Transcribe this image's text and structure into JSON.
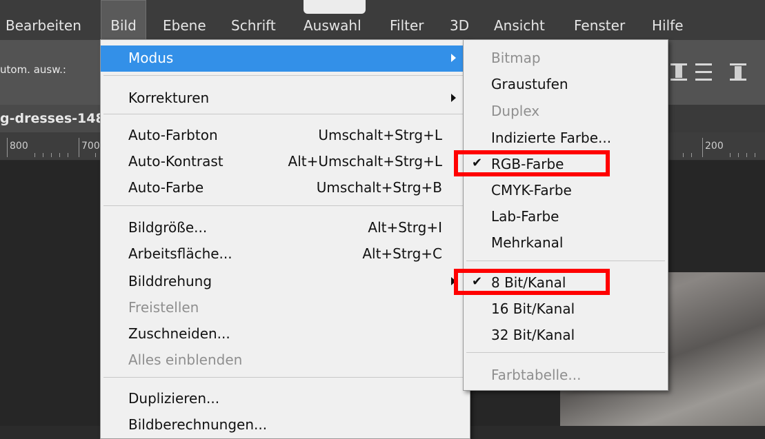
{
  "menubar": {
    "items": [
      {
        "label": "Bearbeiten"
      },
      {
        "label": "Bild"
      },
      {
        "label": "Ebene"
      },
      {
        "label": "Schrift"
      },
      {
        "label": "Auswahl"
      },
      {
        "label": "Filter"
      },
      {
        "label": "3D"
      },
      {
        "label": "Ansicht"
      },
      {
        "label": "Fenster"
      },
      {
        "label": "Hilfe"
      }
    ],
    "active": "Bild"
  },
  "options_bar": {
    "auto_select_label": "utom. ausw.:"
  },
  "document": {
    "tab_title": "g-dresses-148"
  },
  "ruler": {
    "labels": [
      "800",
      "700",
      "200"
    ]
  },
  "bild_menu": {
    "items": [
      {
        "label": "Modus",
        "shortcut": "",
        "submenu": true,
        "highlighted": true
      },
      {
        "label": "Korrekturen",
        "shortcut": "",
        "submenu": true
      },
      {
        "label": "Auto-Farbton",
        "shortcut": "Umschalt+Strg+L"
      },
      {
        "label": "Auto-Kontrast",
        "shortcut": "Alt+Umschalt+Strg+L"
      },
      {
        "label": "Auto-Farbe",
        "shortcut": "Umschalt+Strg+B"
      },
      {
        "label": "Bildgröße...",
        "shortcut": "Alt+Strg+I"
      },
      {
        "label": "Arbeitsfläche...",
        "shortcut": "Alt+Strg+C"
      },
      {
        "label": "Bilddrehung",
        "shortcut": "",
        "submenu": true
      },
      {
        "label": "Freistellen",
        "shortcut": "",
        "disabled": true
      },
      {
        "label": "Zuschneiden...",
        "shortcut": ""
      },
      {
        "label": "Alles einblenden",
        "shortcut": "",
        "disabled": true
      },
      {
        "label": "Duplizieren...",
        "shortcut": ""
      },
      {
        "label": "Bildberechnungen...",
        "shortcut": ""
      }
    ]
  },
  "modus_menu": {
    "items": [
      {
        "label": "Bitmap",
        "disabled": true
      },
      {
        "label": "Graustufen"
      },
      {
        "label": "Duplex",
        "disabled": true
      },
      {
        "label": "Indizierte Farbe..."
      },
      {
        "label": "RGB-Farbe",
        "checked": true
      },
      {
        "label": "CMYK-Farbe"
      },
      {
        "label": "Lab-Farbe"
      },
      {
        "label": "Mehrkanal"
      },
      {
        "label": "8 Bit/Kanal",
        "checked": true
      },
      {
        "label": "16 Bit/Kanal"
      },
      {
        "label": "32 Bit/Kanal"
      },
      {
        "label": "Farbtabelle...",
        "disabled": true
      }
    ],
    "check_glyph": "✔"
  },
  "colors": {
    "highlight": "#3390e8",
    "annotation_red": "#ff0000"
  }
}
